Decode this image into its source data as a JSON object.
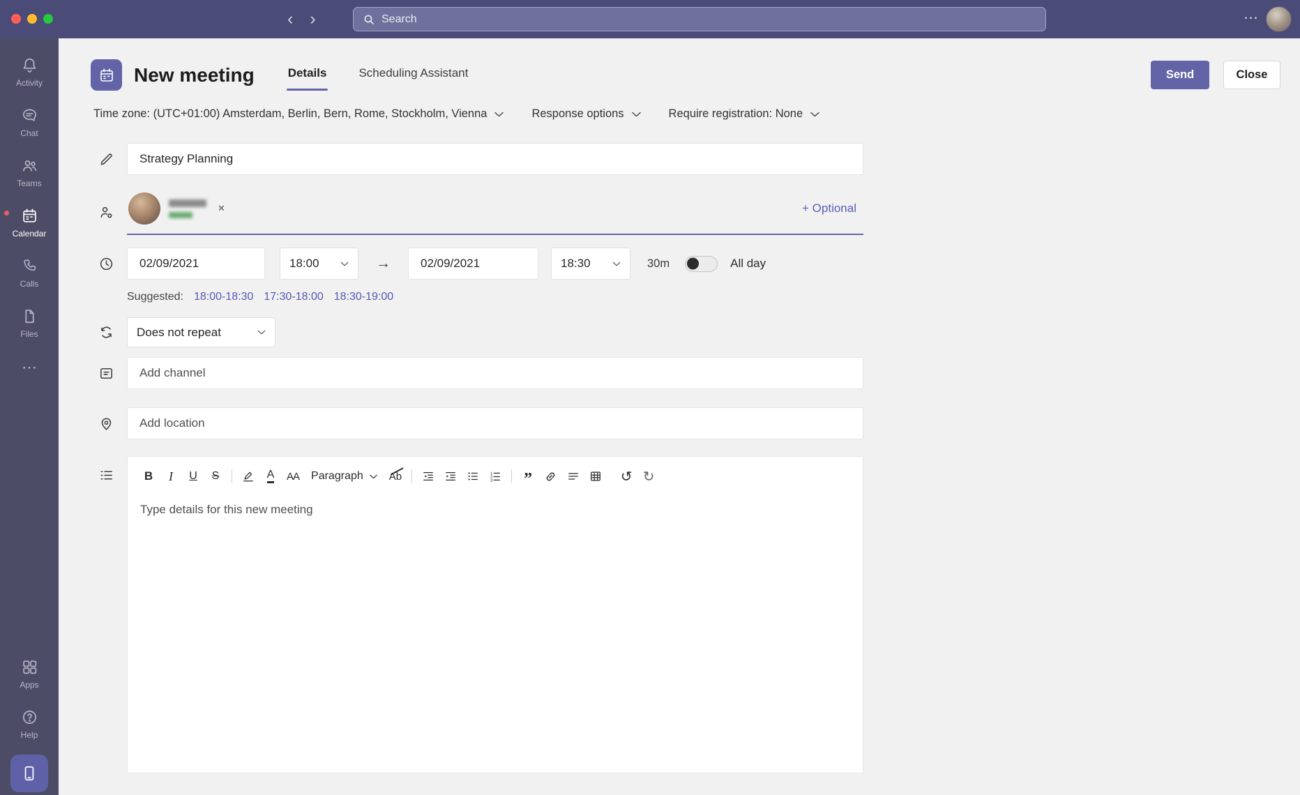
{
  "colors": {
    "accent": "#6264a7",
    "topbar_bg": "#4a4b76",
    "sidebar_bg": "#4d4c66",
    "link": "#5558b0",
    "status_free_green": "#6cab72",
    "traffic_red": "#ff5f57",
    "traffic_yellow": "#febc2e",
    "traffic_green": "#28c840"
  },
  "icons": {
    "chevron_left": "‹",
    "chevron_right": "›",
    "ellipsis": "⋯",
    "more_horizontal": "⋯",
    "arrow_right": "→",
    "remove_chip": "✕",
    "bold": "B",
    "italic": "I",
    "underline": "U",
    "strikethrough": "S",
    "font_color": "A",
    "font_size": "AA",
    "clear_format": "Ab",
    "quote": "”",
    "undo": "↺",
    "redo": "↻"
  },
  "topbar": {
    "search_placeholder": "Search"
  },
  "sidebar": {
    "items": [
      {
        "label": "Activity"
      },
      {
        "label": "Chat"
      },
      {
        "label": "Teams"
      },
      {
        "label": "Calendar",
        "active": true
      },
      {
        "label": "Calls"
      },
      {
        "label": "Files"
      }
    ],
    "bottom_items": [
      {
        "label": "Apps"
      },
      {
        "label": "Help"
      }
    ]
  },
  "header": {
    "title": "New meeting",
    "tabs": [
      {
        "label": "Details"
      },
      {
        "label": "Scheduling Assistant"
      }
    ],
    "send_label": "Send",
    "close_label": "Close"
  },
  "options": {
    "timezone": "Time zone: (UTC+01:00) Amsterdam, Berlin, Bern, Rome, Stockholm, Vienna",
    "response_options": "Response options",
    "require_registration": "Require registration: None"
  },
  "form": {
    "title_value": "Strategy Planning",
    "attendees": {
      "optional_label": "+ Optional",
      "attendee_redacted": true
    },
    "datetime": {
      "start_date": "02/09/2021",
      "start_time": "18:00",
      "end_date": "02/09/2021",
      "end_time": "18:30",
      "duration": "30m",
      "all_day_label": "All day",
      "all_day_on": false
    },
    "suggested": {
      "label": "Suggested:",
      "times": [
        "18:00-18:30",
        "17:30-18:00",
        "18:30-19:00"
      ]
    },
    "repeat_value": "Does not repeat",
    "channel_placeholder": "Add channel",
    "location_placeholder": "Add location",
    "editor": {
      "toolbar": {
        "paragraph": "Paragraph"
      },
      "placeholder": "Type details for this new meeting"
    }
  }
}
